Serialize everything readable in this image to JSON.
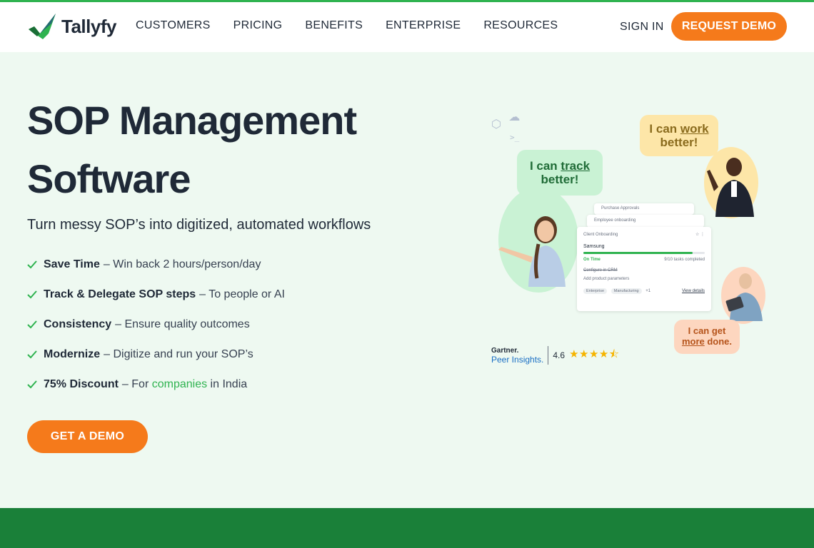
{
  "brand": {
    "name": "Tallyfy",
    "accent": "#2fb350",
    "cta": "#f57a1b"
  },
  "nav": {
    "items": [
      "CUSTOMERS",
      "PRICING",
      "BENEFITS",
      "ENTERPRISE",
      "RESOURCES"
    ],
    "sign_in": "SIGN IN",
    "request_demo": "REQUEST DEMO"
  },
  "hero": {
    "title": "SOP Management Software",
    "subtitle": "Turn messy SOP’s into digitized, automated workflows",
    "benefits": [
      {
        "bold": "Save Time",
        "rest": "– Win back 2 hours/person/day"
      },
      {
        "bold": "Track & Delegate SOP steps",
        "rest": "– To people or AI"
      },
      {
        "bold": "Consistency",
        "rest": "– Ensure quality outcomes"
      },
      {
        "bold": "Modernize",
        "rest": "– Digitize and run your SOP’s"
      },
      {
        "bold": "75% Discount",
        "rest_before": "– For",
        "link": "companies",
        "rest_after": "in India"
      }
    ],
    "cta": "GET A DEMO"
  },
  "illustration": {
    "bubble_track": {
      "line1_pre": "I can ",
      "line1_em": "track",
      "line2": "better!"
    },
    "bubble_work": {
      "line1_pre": "I can ",
      "line1_em": "work",
      "line2": "better!"
    },
    "bubble_more": {
      "line1": "I can get",
      "line2_em": "more",
      "line2_post": " done."
    },
    "card": {
      "back1": "Purchase Approvals",
      "back2": "Employee onboarding",
      "title": "Client Onboarding",
      "company": "Samsung",
      "progress": 0.9,
      "status": "On Time",
      "tasks": "9/10 tasks completed",
      "task1": "Configure in CRM",
      "task2": "Add product parameters",
      "tags": [
        "Enterprise",
        "Manufacturing"
      ],
      "more_tags": "+1",
      "view_details": "View details"
    },
    "rating": {
      "source_line1": "Gartner.",
      "source_line2": "Peer Insights.",
      "score": "4.6",
      "stars": "★★★★⯪"
    }
  }
}
